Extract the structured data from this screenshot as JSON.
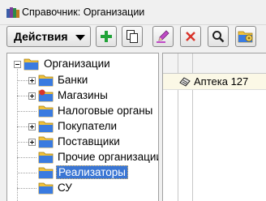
{
  "window": {
    "title": "Справочник: Организации"
  },
  "toolbar": {
    "actions_label": "Действия"
  },
  "tree": {
    "root": "Организации",
    "items": [
      "Банки",
      "Магазины",
      "Налоговые органы",
      "Покупатели",
      "Поставщики",
      "Прочие организации",
      "Реализаторы",
      "СУ"
    ],
    "selected": "Реализаторы"
  },
  "grid": {
    "rows": [
      {
        "name": "Аптека 127"
      }
    ]
  },
  "colors": {
    "selection": "#3a76d4",
    "row_highlight": "#fbf8e6",
    "add": "#21a338",
    "delete": "#d9342b"
  }
}
